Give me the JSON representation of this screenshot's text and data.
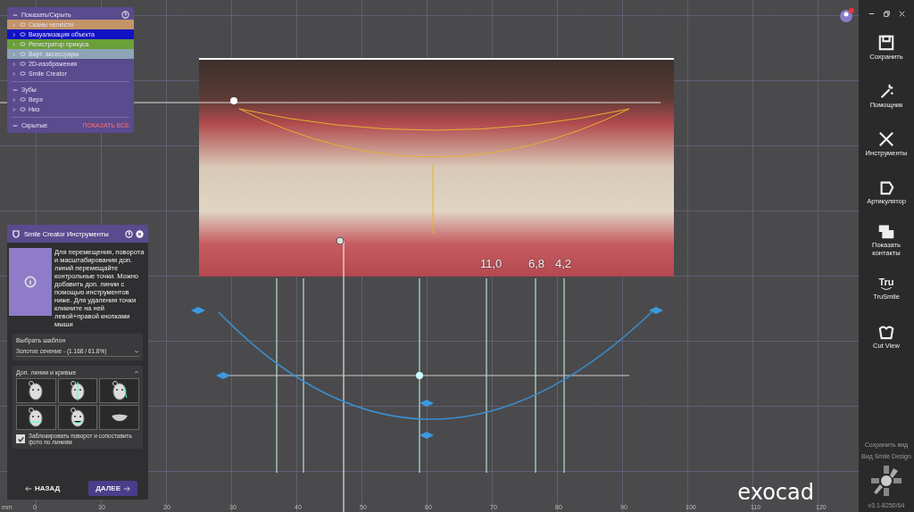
{
  "show_hide": {
    "title": "Показать/Скрыть",
    "items": [
      {
        "label": "Сканы челюсти",
        "color": "#c39468"
      },
      {
        "label": "Визуализация объекта",
        "color": "#1212c4"
      },
      {
        "label": "Регистратор прикуса",
        "color": "#6b9f3a"
      },
      {
        "label": "Вирт. аксессуары",
        "color": "#8ea4b6"
      },
      {
        "label": "2D-изображения"
      },
      {
        "label": "Smile Creator"
      }
    ],
    "teeth_title": "Зубы",
    "teeth": [
      {
        "label": "Верх"
      },
      {
        "label": "Низ"
      }
    ],
    "hidden_label": "Скрытые",
    "show_all": "ПОКАЗАТЬ ВСЕ"
  },
  "tools_panel": {
    "title": "Smile Creator Инструменты",
    "info": "Для перемещения, поворота и масштабирования доп. линий перемещайте контрольные точки. Можно добавить доп. линии с помощью инструментов ниже. Для удаления точки кликните на ней левой+правой кнопками мыши",
    "template_label": "Выбрать шаблон",
    "template_value": "Золотое сечение - (1.168 / 61.8%)",
    "lines_title": "Доп. линии и кривые",
    "tools": [
      {
        "kind": "face"
      },
      {
        "kind": "face-midline"
      },
      {
        "kind": "face-side"
      },
      {
        "kind": "face-lower"
      },
      {
        "kind": "face-smile"
      },
      {
        "kind": "mouth"
      }
    ],
    "lock_label": "Заблокировать поворот и сопоставить фото по линиям",
    "lock_checked": true,
    "back": "НАЗАД",
    "next": "ДАЛЕЕ"
  },
  "measurements": [
    "11,0",
    "6,8",
    "4,2"
  ],
  "x_axis": {
    "unit": "mm",
    "ticks": [
      "0",
      "10",
      "20",
      "30",
      "40",
      "50",
      "60",
      "70",
      "80",
      "90",
      "100",
      "110",
      "120"
    ]
  },
  "logo": "exocad",
  "sidebar": {
    "items": [
      {
        "kind": "save",
        "label": "Сохранить"
      },
      {
        "kind": "wizard",
        "label": "Помощник"
      },
      {
        "kind": "tools",
        "label": "Инструменты"
      },
      {
        "kind": "articulator",
        "label": "Артикулятор"
      },
      {
        "kind": "contacts",
        "label": "Показать контакты"
      },
      {
        "kind": "trusmile",
        "label": "TruSmile",
        "icon_text": "Tru"
      },
      {
        "kind": "cutview",
        "label": "Cut View"
      }
    ],
    "save_view": "Сохранить вид",
    "view_name": "Вид Smile Design",
    "version": "v3.1-8250/64"
  }
}
